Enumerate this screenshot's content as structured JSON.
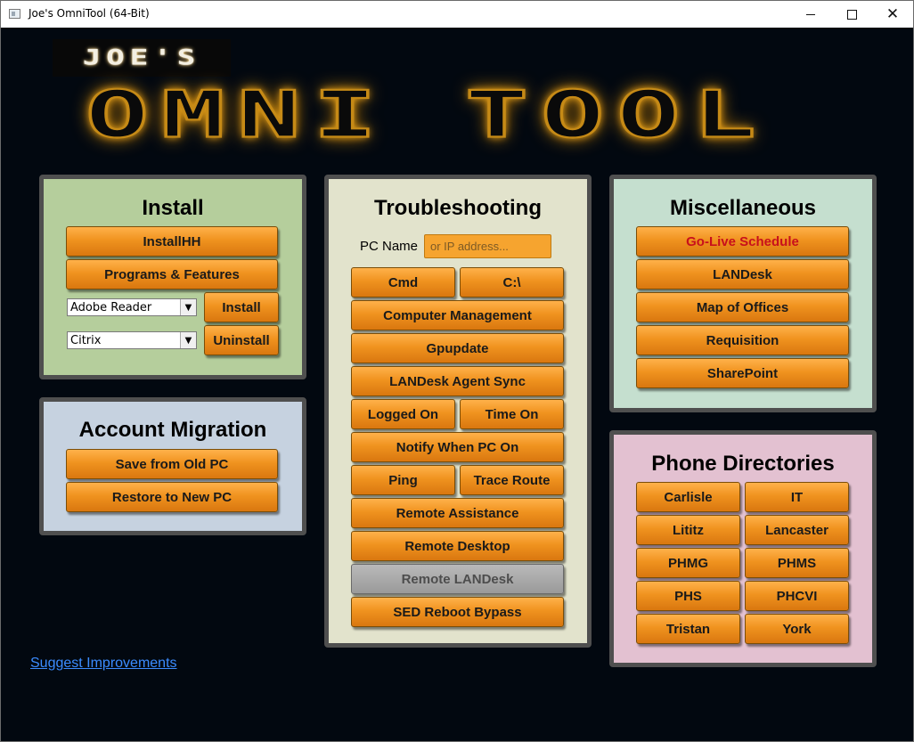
{
  "window": {
    "title": "Joe's OmniTool (64-Bit)"
  },
  "logo": {
    "line1": "JOE'S",
    "line2": "OMNI TOOL"
  },
  "install": {
    "title": "Install",
    "installhh": "InstallHH",
    "programs": "Programs & Features",
    "select1": "Adobe Reader",
    "install_btn": "Install",
    "select2": "Citrix",
    "uninstall_btn": "Uninstall"
  },
  "account": {
    "title": "Account Migration",
    "save": "Save from Old PC",
    "restore": "Restore to New PC"
  },
  "trouble": {
    "title": "Troubleshooting",
    "pc_label": "PC Name",
    "pc_placeholder": "or IP address...",
    "cmd": "Cmd",
    "cdrive": "C:\\",
    "compmgmt": "Computer Management",
    "gpupdate": "Gpupdate",
    "agentsync": "LANDesk Agent Sync",
    "loggedon": "Logged On",
    "timeon": "Time On",
    "notify": "Notify When PC On",
    "ping": "Ping",
    "traceroute": "Trace Route",
    "remoteassist": "Remote Assistance",
    "remotedesktop": "Remote Desktop",
    "remotelandesk": "Remote LANDesk",
    "sedreboot": "SED Reboot Bypass"
  },
  "misc": {
    "title": "Miscellaneous",
    "golive": "Go-Live Schedule",
    "landesk": "LANDesk",
    "map": "Map of Offices",
    "requisition": "Requisition",
    "sharepoint": "SharePoint"
  },
  "phone": {
    "title": "Phone Directories",
    "carlisle": "Carlisle",
    "it": "IT",
    "lititz": "Lititz",
    "lancaster": "Lancaster",
    "phmg": "PHMG",
    "phms": "PHMS",
    "phs": "PHS",
    "phcvi": "PHCVI",
    "tristan": "Tristan",
    "york": "York"
  },
  "suggest_link": "Suggest Improvements",
  "colors": {
    "button_orange": "#f0931f",
    "install_panel": "#b5ce9c",
    "account_panel": "#c6d2e0",
    "trouble_panel": "#e2e3cc",
    "misc_panel": "#c5dfcf",
    "phone_panel": "#e3c1d1",
    "background": "#020810"
  }
}
